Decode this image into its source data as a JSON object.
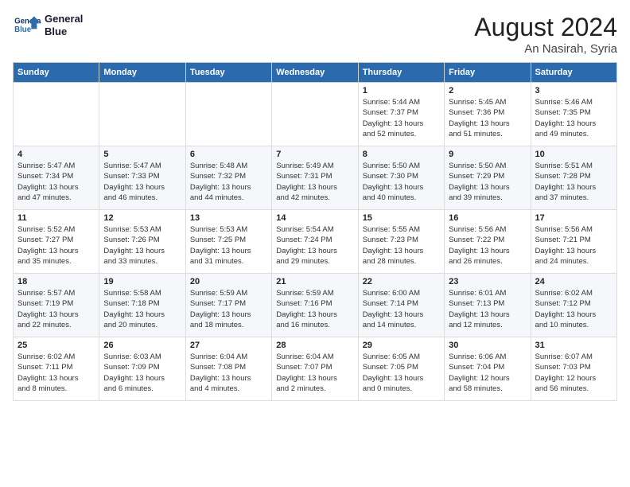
{
  "header": {
    "logo_line1": "General",
    "logo_line2": "Blue",
    "month_year": "August 2024",
    "location": "An Nasirah, Syria"
  },
  "weekdays": [
    "Sunday",
    "Monday",
    "Tuesday",
    "Wednesday",
    "Thursday",
    "Friday",
    "Saturday"
  ],
  "weeks": [
    [
      {
        "day": "",
        "info": ""
      },
      {
        "day": "",
        "info": ""
      },
      {
        "day": "",
        "info": ""
      },
      {
        "day": "",
        "info": ""
      },
      {
        "day": "1",
        "info": "Sunrise: 5:44 AM\nSunset: 7:37 PM\nDaylight: 13 hours\nand 52 minutes."
      },
      {
        "day": "2",
        "info": "Sunrise: 5:45 AM\nSunset: 7:36 PM\nDaylight: 13 hours\nand 51 minutes."
      },
      {
        "day": "3",
        "info": "Sunrise: 5:46 AM\nSunset: 7:35 PM\nDaylight: 13 hours\nand 49 minutes."
      }
    ],
    [
      {
        "day": "4",
        "info": "Sunrise: 5:47 AM\nSunset: 7:34 PM\nDaylight: 13 hours\nand 47 minutes."
      },
      {
        "day": "5",
        "info": "Sunrise: 5:47 AM\nSunset: 7:33 PM\nDaylight: 13 hours\nand 46 minutes."
      },
      {
        "day": "6",
        "info": "Sunrise: 5:48 AM\nSunset: 7:32 PM\nDaylight: 13 hours\nand 44 minutes."
      },
      {
        "day": "7",
        "info": "Sunrise: 5:49 AM\nSunset: 7:31 PM\nDaylight: 13 hours\nand 42 minutes."
      },
      {
        "day": "8",
        "info": "Sunrise: 5:50 AM\nSunset: 7:30 PM\nDaylight: 13 hours\nand 40 minutes."
      },
      {
        "day": "9",
        "info": "Sunrise: 5:50 AM\nSunset: 7:29 PM\nDaylight: 13 hours\nand 39 minutes."
      },
      {
        "day": "10",
        "info": "Sunrise: 5:51 AM\nSunset: 7:28 PM\nDaylight: 13 hours\nand 37 minutes."
      }
    ],
    [
      {
        "day": "11",
        "info": "Sunrise: 5:52 AM\nSunset: 7:27 PM\nDaylight: 13 hours\nand 35 minutes."
      },
      {
        "day": "12",
        "info": "Sunrise: 5:53 AM\nSunset: 7:26 PM\nDaylight: 13 hours\nand 33 minutes."
      },
      {
        "day": "13",
        "info": "Sunrise: 5:53 AM\nSunset: 7:25 PM\nDaylight: 13 hours\nand 31 minutes."
      },
      {
        "day": "14",
        "info": "Sunrise: 5:54 AM\nSunset: 7:24 PM\nDaylight: 13 hours\nand 29 minutes."
      },
      {
        "day": "15",
        "info": "Sunrise: 5:55 AM\nSunset: 7:23 PM\nDaylight: 13 hours\nand 28 minutes."
      },
      {
        "day": "16",
        "info": "Sunrise: 5:56 AM\nSunset: 7:22 PM\nDaylight: 13 hours\nand 26 minutes."
      },
      {
        "day": "17",
        "info": "Sunrise: 5:56 AM\nSunset: 7:21 PM\nDaylight: 13 hours\nand 24 minutes."
      }
    ],
    [
      {
        "day": "18",
        "info": "Sunrise: 5:57 AM\nSunset: 7:19 PM\nDaylight: 13 hours\nand 22 minutes."
      },
      {
        "day": "19",
        "info": "Sunrise: 5:58 AM\nSunset: 7:18 PM\nDaylight: 13 hours\nand 20 minutes."
      },
      {
        "day": "20",
        "info": "Sunrise: 5:59 AM\nSunset: 7:17 PM\nDaylight: 13 hours\nand 18 minutes."
      },
      {
        "day": "21",
        "info": "Sunrise: 5:59 AM\nSunset: 7:16 PM\nDaylight: 13 hours\nand 16 minutes."
      },
      {
        "day": "22",
        "info": "Sunrise: 6:00 AM\nSunset: 7:14 PM\nDaylight: 13 hours\nand 14 minutes."
      },
      {
        "day": "23",
        "info": "Sunrise: 6:01 AM\nSunset: 7:13 PM\nDaylight: 13 hours\nand 12 minutes."
      },
      {
        "day": "24",
        "info": "Sunrise: 6:02 AM\nSunset: 7:12 PM\nDaylight: 13 hours\nand 10 minutes."
      }
    ],
    [
      {
        "day": "25",
        "info": "Sunrise: 6:02 AM\nSunset: 7:11 PM\nDaylight: 13 hours\nand 8 minutes."
      },
      {
        "day": "26",
        "info": "Sunrise: 6:03 AM\nSunset: 7:09 PM\nDaylight: 13 hours\nand 6 minutes."
      },
      {
        "day": "27",
        "info": "Sunrise: 6:04 AM\nSunset: 7:08 PM\nDaylight: 13 hours\nand 4 minutes."
      },
      {
        "day": "28",
        "info": "Sunrise: 6:04 AM\nSunset: 7:07 PM\nDaylight: 13 hours\nand 2 minutes."
      },
      {
        "day": "29",
        "info": "Sunrise: 6:05 AM\nSunset: 7:05 PM\nDaylight: 13 hours\nand 0 minutes."
      },
      {
        "day": "30",
        "info": "Sunrise: 6:06 AM\nSunset: 7:04 PM\nDaylight: 12 hours\nand 58 minutes."
      },
      {
        "day": "31",
        "info": "Sunrise: 6:07 AM\nSunset: 7:03 PM\nDaylight: 12 hours\nand 56 minutes."
      }
    ]
  ]
}
